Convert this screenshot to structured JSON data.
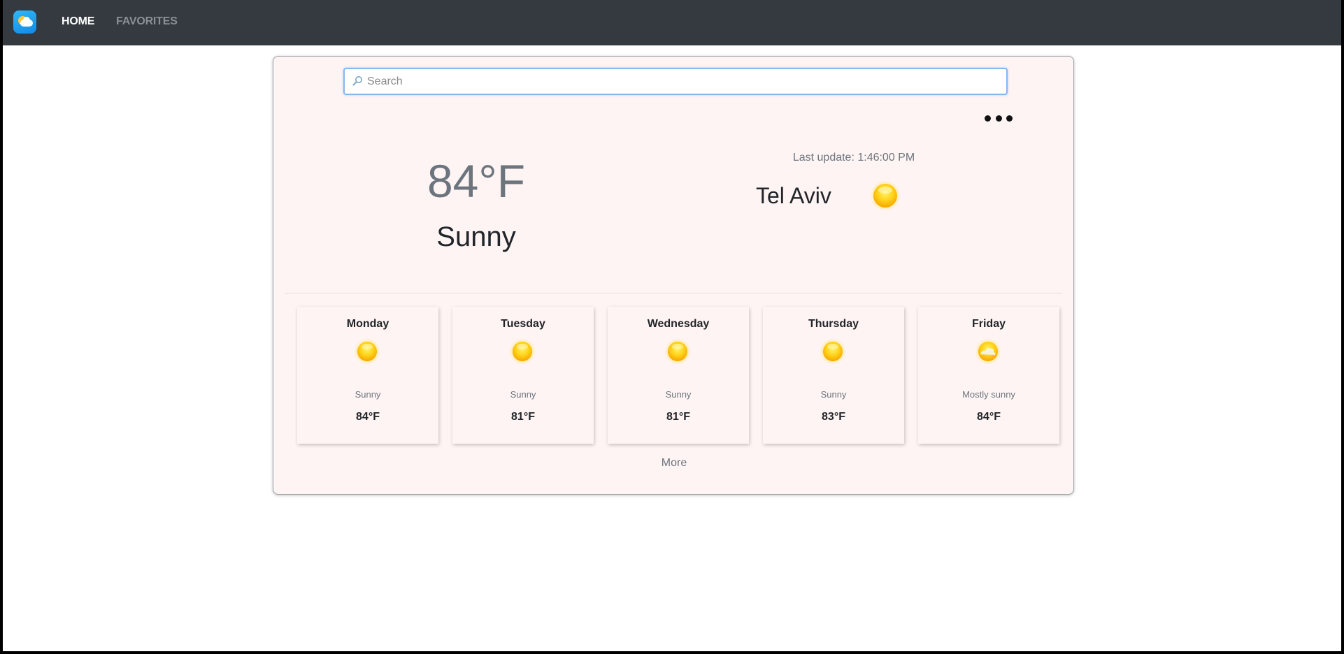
{
  "nav": {
    "logo_icon": "weather-app-logo-icon",
    "home_label": "HOME",
    "favorites_label": "FAVORITES"
  },
  "search": {
    "placeholder": "Search",
    "value": "",
    "icon": "search-icon"
  },
  "menu": {
    "icon": "more-options-icon"
  },
  "current": {
    "temperature": "84°F",
    "condition": "Sunny",
    "last_update": "Last update: 1:46:00 PM",
    "city": "Tel Aviv",
    "icon": "sun-icon"
  },
  "forecast": [
    {
      "day": "Monday",
      "condition": "Sunny",
      "temperature": "84°F",
      "icon": "sun-icon"
    },
    {
      "day": "Tuesday",
      "condition": "Sunny",
      "temperature": "81°F",
      "icon": "sun-icon"
    },
    {
      "day": "Wednesday",
      "condition": "Sunny",
      "temperature": "81°F",
      "icon": "sun-icon"
    },
    {
      "day": "Thursday",
      "condition": "Sunny",
      "temperature": "83°F",
      "icon": "sun-icon"
    },
    {
      "day": "Friday",
      "condition": "Mostly sunny",
      "temperature": "84°F",
      "icon": "mostly-sunny-icon"
    }
  ],
  "more_label": "More",
  "colors": {
    "navbar": "#343a40",
    "card_background": "#fff4f4",
    "sun": "#ffc20e",
    "muted_text": "#6c757d"
  }
}
